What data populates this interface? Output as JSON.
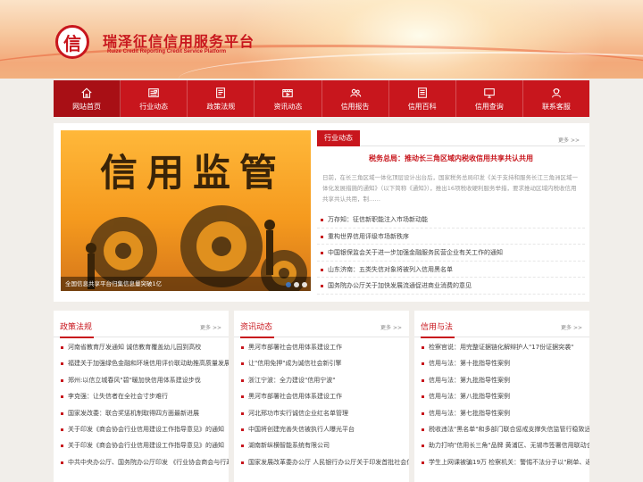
{
  "header": {
    "logo_char": "信",
    "title": "瑞泽征信信用服务平台",
    "subtitle": "Ruize Credit Reporting Credit Service Platform"
  },
  "nav": {
    "items": [
      {
        "label": "网站首页",
        "icon": "home-icon"
      },
      {
        "label": "行业动态",
        "icon": "newspaper-icon"
      },
      {
        "label": "政策法规",
        "icon": "document-icon"
      },
      {
        "label": "资讯动态",
        "icon": "video-icon"
      },
      {
        "label": "信用报告",
        "icon": "users-icon"
      },
      {
        "label": "信用百科",
        "icon": "book-icon"
      },
      {
        "label": "信用查询",
        "icon": "monitor-icon"
      },
      {
        "label": "联系客服",
        "icon": "service-icon"
      }
    ],
    "active_index": 0
  },
  "slider": {
    "big_text": "信用监管",
    "caption": "全国信息共享平台归集信息量突破1亿",
    "dot_count": 3,
    "active_dot": 0
  },
  "industry": {
    "tag": "行业动态",
    "more": "更多 >>",
    "headline": "税务总局：推动长三角区域内税收信用共享共认共用",
    "summary": "日前，在长三角区域一体化顶层设计出台后，国家税务总局印发《关于支持和服务长江三角洲区域一体化发展措施的通知》（以下简称《通知》），推出16项税收硬利服务举措，要求推动区域内税收信用共享共认共用，制……",
    "items": [
      "万存知：征信新职能注入市场新动能",
      "重构世界信用评级市场新秩序",
      "中国银保监会关于进一步加强金融服务民营企业有关工作的通知",
      "山东济南：五类失信对象将被列入信用黑名单",
      "国务院办公厅关于加快发展流通促进商业消费的意见"
    ]
  },
  "columns": [
    {
      "title": "政策法规",
      "more": "更多 >>",
      "items": [
        "河南省教育厅发通知 诚信教育覆盖幼儿园到高校",
        "福建关于加强绿色金融和环境信用评价联动助推高质量发展",
        "郑州:以信立城春风\"碧\"暖加快信用体系建设步伐",
        "李克强：让失信者在全社会寸步难行",
        "国家发改委：联合奖惩机制取得四方面最新进展",
        "关于印发《商会协会行业信用建设工作指导意见》的通知",
        "关于印发《商会协会行业信用建设工作指导意见》的通知",
        "中共中央办公厅、国务院办公厅印发 《行业协会商会与行政机关脱钩"
      ]
    },
    {
      "title": "资讯动态",
      "more": "更多 >>",
      "items": [
        "黑河市部署社会信用体系建设工作",
        "让\"信用免押\"成为诚信社会新引擎",
        "浙江宁波：全力建设\"信用宁波\"",
        "黑河市部署社会信用体系建设工作",
        "河北邢功市实行诚信企业红名单管理",
        "中国将创建完善失信被执行人曝光平台",
        "湖南新纵横智能系统有限公司",
        "国家发展改革委办公厅 人民银行办公厅关于印发首批社会信用体系建设"
      ]
    },
    {
      "title": "信用与法",
      "more": "更多 >>",
      "items": [
        "检察官说：用完整证据链化解辩护人\"17份证据突袭\"",
        "信用与法：第十批指导性案例",
        "信用与法：第九批指导性案例",
        "信用与法：第八批指导性案例",
        "信用与法：第七批指导性案例",
        "税收违法\"黑名单\"和多部门联合惩戒支撑失信监管行稳致远",
        "助力打响\"信用长三角\"品牌 黄浦区、无锡市签署信用联动合作协议",
        "学生上网课被骗19万 检察机关：警惕不法分子以\"刷单、返利\"为名"
      ]
    }
  ],
  "colors": {
    "brand_red": "#c8161d",
    "nav_active": "#a80f15",
    "slider_orange": "#f59a1e"
  }
}
